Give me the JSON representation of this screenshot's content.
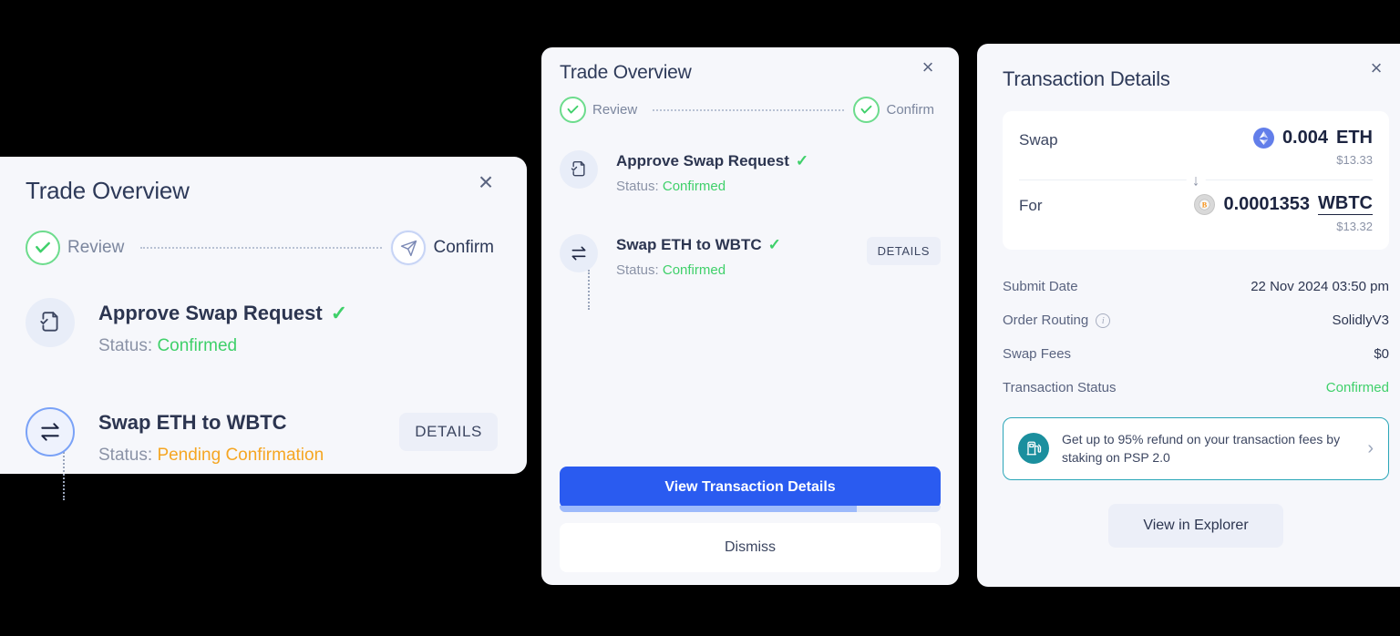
{
  "left_panel": {
    "title": "Trade Overview",
    "close_label": "×",
    "stepper": {
      "step1_label": "Review",
      "step1_state": "done",
      "step2_label": "Confirm",
      "step2_state": "pending"
    },
    "tasks": [
      {
        "icon": "document-check-icon",
        "name": "Approve Swap Request",
        "check": "✓",
        "status_label": "Status:",
        "status_value": "Confirmed",
        "status_state": "confirmed",
        "has_details": false
      },
      {
        "icon": "swap-arrows-icon",
        "name": "Swap ETH to WBTC",
        "check": "",
        "status_label": "Status:",
        "status_value": "Pending Confirmation",
        "status_state": "pending",
        "has_details": true,
        "details_label": "DETAILS"
      }
    ]
  },
  "mid_panel": {
    "title": "Trade Overview",
    "close_label": "×",
    "stepper": {
      "step1_label": "Review",
      "step1_state": "done",
      "step2_label": "Confirm",
      "step2_state": "done"
    },
    "tasks": [
      {
        "icon": "document-check-icon",
        "name": "Approve Swap Request",
        "check": "✓",
        "status_label": "Status:",
        "status_value": "Confirmed",
        "status_state": "confirmed",
        "has_details": false
      },
      {
        "icon": "swap-arrows-icon",
        "name": "Swap ETH to WBTC",
        "check": "✓",
        "status_label": "Status:",
        "status_value": "Confirmed",
        "status_state": "confirmed",
        "has_details": true,
        "details_label": "DETAILS"
      }
    ],
    "primary_button": "View Transaction Details",
    "progress_percent": 78,
    "secondary_button": "Dismiss"
  },
  "right_panel": {
    "title": "Transaction Details",
    "close_label": "×",
    "swap_card": {
      "from_label": "Swap",
      "from_amount": "0.004",
      "from_symbol": "ETH",
      "from_usd": "$13.33",
      "from_token_icon": "ethereum-icon",
      "arrow": "↓",
      "to_label": "For",
      "to_amount": "0.0001353",
      "to_symbol": "WBTC",
      "to_usd": "$13.32",
      "to_token_icon": "wrapped-bitcoin-icon"
    },
    "details": [
      {
        "key": "Submit Date",
        "value": "22 Nov 2024 03:50 pm",
        "info": false,
        "state": ""
      },
      {
        "key": "Order Routing",
        "value": "SolidlyV3",
        "info": true,
        "state": ""
      },
      {
        "key": "Swap Fees",
        "value": "$0",
        "info": false,
        "state": ""
      },
      {
        "key": "Transaction Status",
        "value": "Confirmed",
        "info": false,
        "state": "confirmed"
      }
    ],
    "promo": {
      "icon": "gas-pump-icon",
      "text": "Get up to 95% refund on your transaction fees by staking on PSP 2.0",
      "chevron": "›"
    },
    "explorer_button": "View in Explorer"
  },
  "colors": {
    "panel_bg": "#f6f7fb",
    "accent_blue": "#2a5bf0",
    "success_green": "#3fd06a",
    "pending_orange": "#f5a623",
    "promo_teal": "#2aa6b8",
    "eth_purple": "#627eea",
    "wbtc_orange": "#f7931a"
  }
}
